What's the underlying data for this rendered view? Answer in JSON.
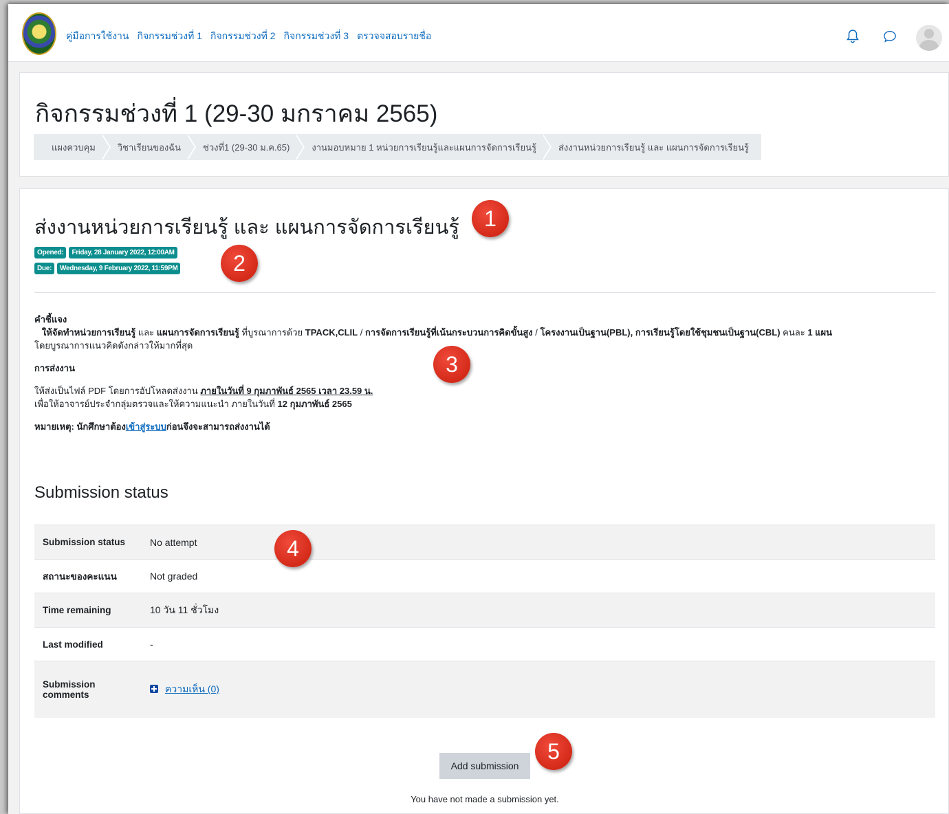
{
  "nav": {
    "links": [
      "คู่มือการใช้งาน",
      "กิจกรรมช่วงที่ 1",
      "กิจกรรมช่วงที่ 2",
      "กิจกรรมช่วงที่ 3",
      "ตรวจจสอบรายชื่อ"
    ],
    "icons": [
      "bell-icon",
      "chat-icon",
      "avatar"
    ]
  },
  "header": {
    "title": "กิจกรรมช่วงที่ 1 (29-30 มกราคม 2565)",
    "breadcrumb": [
      "แผงควบคุม",
      "วิชาเรียนของฉัน",
      "ช่วงที่1 (29-30 ม.ค.65)",
      "งานมอบหมาย 1 หน่วยการเรียนรู้และแผนการจัดการเรียนรู้",
      "ส่งงานหน่วยการเรียนรู้ และ แผนการจัดการเรียนรู้"
    ]
  },
  "activity": {
    "title": "ส่งงานหน่วยการเรียนรู้ และ แผนการจัดการเรียนรู้",
    "opened_label": "Opened:",
    "opened_value": "Friday, 28 January 2022, 12:00AM",
    "due_label": "Due:",
    "due_value": "Wednesday, 9 February 2022, 11:59PM"
  },
  "intro": {
    "instr_heading": "คำชี้แจง",
    "line1_b1": "ให้จัดทำหน่วยการเรียนรู้",
    "line1_t1": " และ ",
    "line1_b2": "แผนการจัดการเรียนรู้",
    "line1_t2": " ที่บูรณาการด้วย ",
    "line1_b3": "TPACK,CLIL",
    "line1_t3": " / ",
    "line1_b4": "การจัดการเรียนรู้ที่เน้นกระบวนการคิดขั้นสูง",
    "line1_t4": " / ",
    "line1_b5": "โครงงานเป็นฐาน(PBL), การเรียนรู้โดยใช้ชุมชนเป็นฐาน(CBL)",
    "line1_t5": " คนละ ",
    "line1_b6": "1 แผน",
    "line2": "โดยบูรณาการแนวคิดดังกล่าวให้มากที่สุด",
    "submit_heading": "การส่งงาน",
    "line3_t1": "ให้ส่งเป็นไฟล์ PDF โดยการอัปโหลดส่งงาน ",
    "line3_b1": "ภายในวันที่ 9 กุมภาพันธ์ 2565 เวลา 23.59 น.",
    "line4_t1": "เพื่อให้อาจารย์ประจำกลุ่มตรวจและให้ความแนะนำ  ภายในวันที่ ",
    "line4_b1": "12 กุมภาพันธ์ 2565",
    "note_t1": "หมายเหตุ: นักศึกษาต้อง",
    "note_link": "เข้าสู่ระบบ",
    "note_t2": "ก่อนจึงจะสามารถส่งงานได้"
  },
  "submission": {
    "heading": "Submission status",
    "rows": [
      {
        "label": "Submission status",
        "value": "No attempt"
      },
      {
        "label": "สถานะของคะแนน",
        "value": "Not graded"
      },
      {
        "label": "Time remaining",
        "value": "10 วัน 11 ชั่วโมง"
      },
      {
        "label": "Last modified",
        "value": "-"
      },
      {
        "label": "Submission comments",
        "value": "ความเห็น (0)"
      }
    ],
    "add_button": "Add submission",
    "none_text": "You have not made a submission yet."
  },
  "markers": [
    "1",
    "2",
    "3",
    "4",
    "5"
  ],
  "colors": {
    "accent": "#0f6cbf",
    "badge": "#0d8e8e",
    "marker": "#e0311f"
  }
}
